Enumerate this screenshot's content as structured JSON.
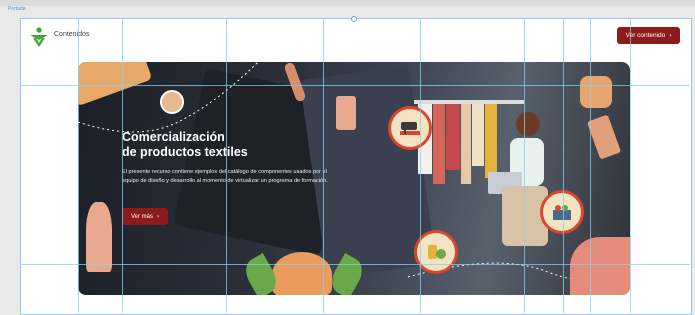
{
  "frame": {
    "tab_label": "Portada"
  },
  "header": {
    "logo_text": "Contenidos",
    "button_label": "Ver contenido",
    "button_icon": "chevron-right-icon"
  },
  "banner": {
    "title_line1": "Comercialización",
    "title_line2": "de productos textiles",
    "description": "El presente recurso contiene ejemplos del catálogo de componentes usados por el equipo de diseño y desarrollo al momento de virtualizar un programa de formación.",
    "button_label": "Ver más",
    "button_icon": "chevron-right-icon"
  },
  "colors": {
    "accent": "#8e1b1b",
    "logo_green": "#39a935",
    "guide": "#7fd4f0",
    "icon_ring": "#d9452f"
  }
}
